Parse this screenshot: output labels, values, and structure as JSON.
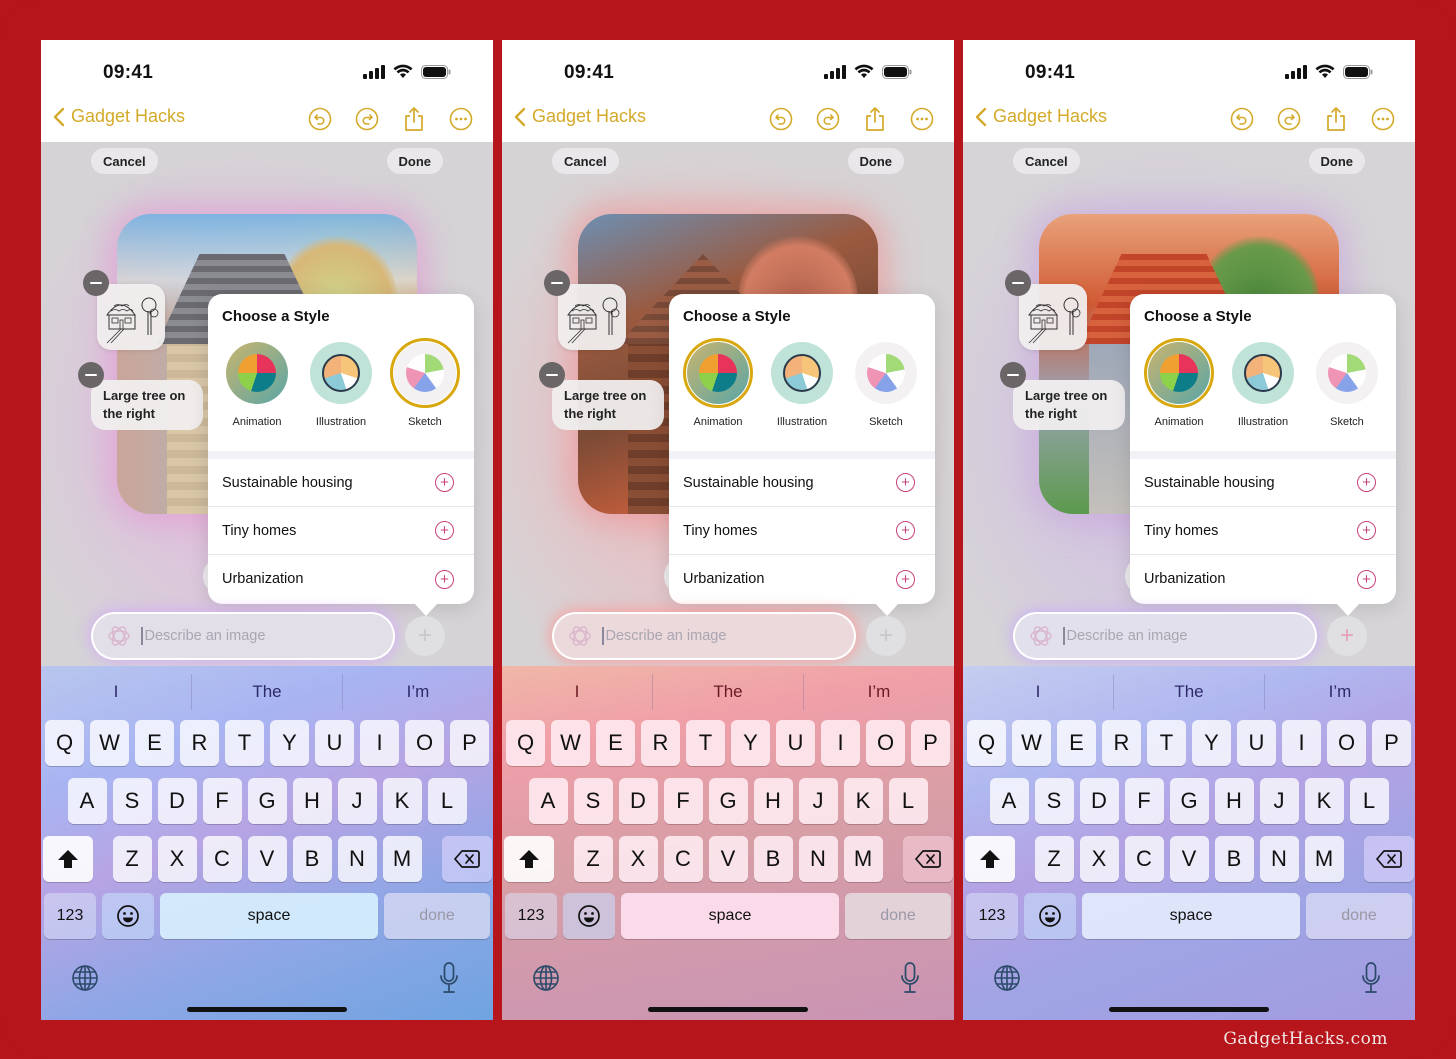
{
  "watermark": "GadgetHacks.com",
  "colors": {
    "frame": "#b5151b",
    "accent": "#d4aa2a",
    "selected_ring": "#d8a80e",
    "suggestion_plus": "#c8417a"
  },
  "phones": [
    {
      "variant": "blue-purple",
      "status": {
        "time": "09:41",
        "icons": [
          "signal-icon",
          "wifi-icon",
          "battery-icon"
        ]
      },
      "nav": {
        "back_label": "Gadget Hacks",
        "actions": [
          "undo-icon",
          "redo-icon",
          "share-icon",
          "more-icon"
        ]
      },
      "sheet": {
        "cancel": "Cancel",
        "done": "Done"
      },
      "chips": {
        "sketch_chip": "house-sketch-thumbnail",
        "text_chip": "Large tree on the right"
      },
      "popover": {
        "title": "Choose a Style",
        "styles": [
          {
            "label": "Animation",
            "selected": false
          },
          {
            "label": "Illustration",
            "selected": false
          },
          {
            "label": "Sketch",
            "selected": true
          }
        ],
        "suggestions": [
          "Sustainable housing",
          "Tiny homes",
          "Urbanization"
        ]
      },
      "prompt": {
        "placeholder": "Describe an image",
        "value": ""
      },
      "keyboard": {
        "predictions": [
          "I",
          "The",
          "I’m"
        ],
        "row1": [
          "Q",
          "W",
          "E",
          "R",
          "T",
          "Y",
          "U",
          "I",
          "O",
          "P"
        ],
        "row2": [
          "A",
          "S",
          "D",
          "F",
          "G",
          "H",
          "J",
          "K",
          "L"
        ],
        "row3": [
          "Z",
          "X",
          "C",
          "V",
          "B",
          "N",
          "M"
        ],
        "numbers": "123",
        "space": "space",
        "done": "done"
      }
    },
    {
      "variant": "pink",
      "status": {
        "time": "09:41",
        "icons": [
          "signal-icon",
          "wifi-icon",
          "battery-icon"
        ]
      },
      "nav": {
        "back_label": "Gadget Hacks",
        "actions": [
          "undo-icon",
          "redo-icon",
          "share-icon",
          "more-icon"
        ]
      },
      "sheet": {
        "cancel": "Cancel",
        "done": "Done"
      },
      "chips": {
        "sketch_chip": "house-sketch-thumbnail",
        "text_chip": "Large tree on the right"
      },
      "popover": {
        "title": "Choose a Style",
        "styles": [
          {
            "label": "Animation",
            "selected": true
          },
          {
            "label": "Illustration",
            "selected": false
          },
          {
            "label": "Sketch",
            "selected": false
          }
        ],
        "suggestions": [
          "Sustainable housing",
          "Tiny homes",
          "Urbanization"
        ]
      },
      "prompt": {
        "placeholder": "Describe an image",
        "value": ""
      },
      "keyboard": {
        "predictions": [
          "I",
          "The",
          "I’m"
        ],
        "row1": [
          "Q",
          "W",
          "E",
          "R",
          "T",
          "Y",
          "U",
          "I",
          "O",
          "P"
        ],
        "row2": [
          "A",
          "S",
          "D",
          "F",
          "G",
          "H",
          "J",
          "K",
          "L"
        ],
        "row3": [
          "Z",
          "X",
          "C",
          "V",
          "B",
          "N",
          "M"
        ],
        "numbers": "123",
        "space": "space",
        "done": "done"
      }
    },
    {
      "variant": "lavender",
      "status": {
        "time": "09:41",
        "icons": [
          "signal-icon",
          "wifi-icon",
          "battery-icon"
        ]
      },
      "nav": {
        "back_label": "Gadget Hacks",
        "actions": [
          "undo-icon",
          "redo-icon",
          "share-icon",
          "more-icon"
        ]
      },
      "sheet": {
        "cancel": "Cancel",
        "done": "Done"
      },
      "chips": {
        "sketch_chip": "house-sketch-thumbnail",
        "text_chip": "Large tree on the right"
      },
      "popover": {
        "title": "Choose a Style",
        "styles": [
          {
            "label": "Animation",
            "selected": true
          },
          {
            "label": "Illustration",
            "selected": false
          },
          {
            "label": "Sketch",
            "selected": false
          }
        ],
        "suggestions": [
          "Sustainable housing",
          "Tiny homes",
          "Urbanization"
        ]
      },
      "prompt": {
        "placeholder": "Describe an image",
        "value": ""
      },
      "keyboard": {
        "predictions": [
          "I",
          "The",
          "I’m"
        ],
        "row1": [
          "Q",
          "W",
          "E",
          "R",
          "T",
          "Y",
          "U",
          "I",
          "O",
          "P"
        ],
        "row2": [
          "A",
          "S",
          "D",
          "F",
          "G",
          "H",
          "J",
          "K",
          "L"
        ],
        "row3": [
          "Z",
          "X",
          "C",
          "V",
          "B",
          "N",
          "M"
        ],
        "numbers": "123",
        "space": "space",
        "done": "done"
      }
    }
  ]
}
